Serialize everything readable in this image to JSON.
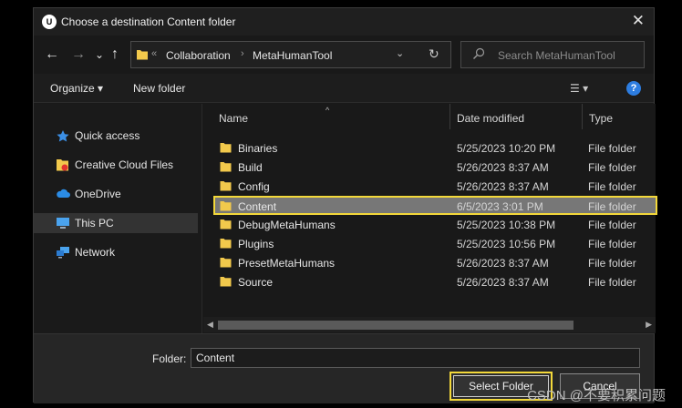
{
  "window": {
    "title": "Choose a destination Content folder",
    "logo_text": "U",
    "close_glyph": "✕"
  },
  "nav": {
    "back": "←",
    "forward": "→",
    "recent": "⌄",
    "up": "↑"
  },
  "address": {
    "prefix": "«",
    "crumbs": [
      "Collaboration",
      "MetaHumanTool"
    ],
    "separator": "›",
    "dropdown_glyph": "⌄",
    "refresh_glyph": "↻"
  },
  "search": {
    "placeholder": "Search MetaHumanTool"
  },
  "toolbar": {
    "organize": "Organize ▾",
    "new_folder": "New folder",
    "view_glyph": "☰ ▾",
    "help_glyph": "?"
  },
  "sidebar": {
    "items": [
      {
        "label": "Quick access",
        "icon": "star-icon"
      },
      {
        "label": "Creative Cloud Files",
        "icon": "creative-cloud-icon"
      },
      {
        "label": "OneDrive",
        "icon": "cloud-icon"
      },
      {
        "label": "This PC",
        "icon": "computer-icon",
        "selected": true
      },
      {
        "label": "Network",
        "icon": "network-icon"
      }
    ]
  },
  "columns": {
    "name": "Name",
    "date": "Date modified",
    "type": "Type",
    "sort_glyph": "^"
  },
  "files": [
    {
      "name": "Binaries",
      "date": "5/25/2023 10:20 PM",
      "type": "File folder"
    },
    {
      "name": "Build",
      "date": "5/26/2023 8:37 AM",
      "type": "File folder"
    },
    {
      "name": "Config",
      "date": "5/26/2023 8:37 AM",
      "type": "File folder"
    },
    {
      "name": "Content",
      "date": "6/5/2023 3:01 PM",
      "type": "File folder",
      "selected": true
    },
    {
      "name": "DebugMetaHumans",
      "date": "5/25/2023 10:38 PM",
      "type": "File folder"
    },
    {
      "name": "Plugins",
      "date": "5/25/2023 10:56 PM",
      "type": "File folder"
    },
    {
      "name": "PresetMetaHumans",
      "date": "5/26/2023 8:37 AM",
      "type": "File folder"
    },
    {
      "name": "Source",
      "date": "5/26/2023 8:37 AM",
      "type": "File folder"
    }
  ],
  "scroll": {
    "left": "◀",
    "right": "▶"
  },
  "footer": {
    "folder_label": "Folder:",
    "folder_value": "Content",
    "select_label": "Select Folder",
    "cancel_label": "Cancel"
  },
  "watermark": "CSDN @不要积累问题",
  "colors": {
    "highlight": "#f3d83a",
    "folder": "#f2c94c",
    "accent_blue": "#2d7de0"
  }
}
